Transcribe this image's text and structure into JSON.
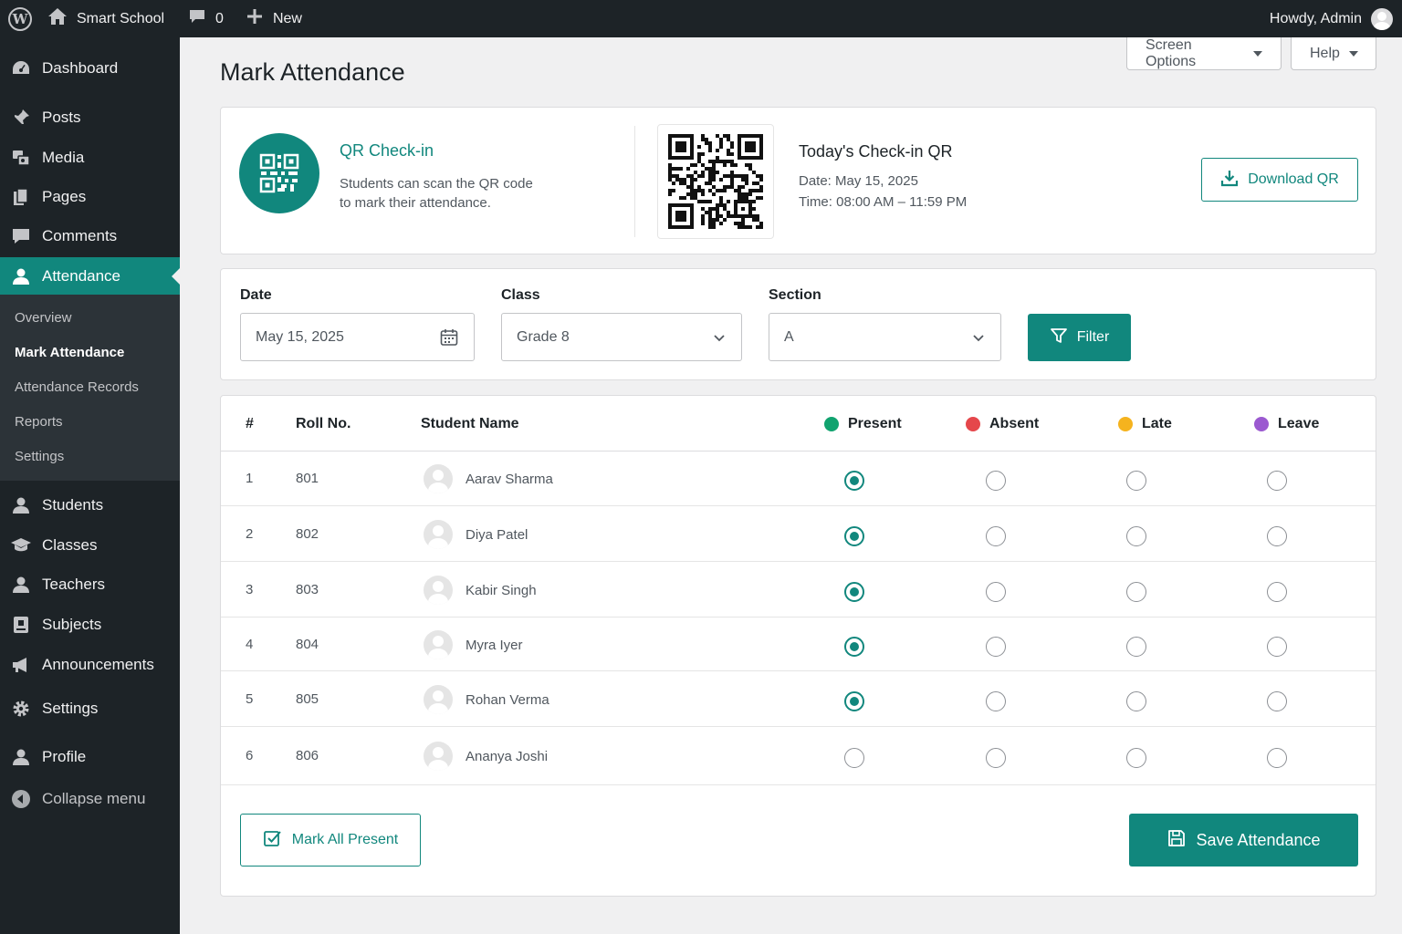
{
  "adminbar": {
    "site_name": "Smart School",
    "comments_count": "0",
    "new_label": "New",
    "howdy": "Howdy, Admin"
  },
  "sidebar": {
    "items": [
      {
        "label": "Dashboard",
        "icon": "dashboard-icon"
      },
      {
        "label": "Posts",
        "icon": "pin-icon"
      },
      {
        "label": "Media",
        "icon": "media-icon"
      },
      {
        "label": "Pages",
        "icon": "pages-icon"
      },
      {
        "label": "Comments",
        "icon": "comment-icon"
      },
      {
        "label": "Attendance",
        "icon": "user-icon"
      },
      {
        "label": "Students",
        "icon": "user-icon"
      },
      {
        "label": "Classes",
        "icon": "graduation-cap-icon"
      },
      {
        "label": "Teachers",
        "icon": "user-icon"
      },
      {
        "label": "Subjects",
        "icon": "book-icon"
      },
      {
        "label": "Announcements",
        "icon": "megaphone-icon"
      },
      {
        "label": "Settings",
        "icon": "gear-icon"
      },
      {
        "label": "Profile",
        "icon": "user-icon"
      }
    ],
    "submenu": [
      "Overview",
      "Mark Attendance",
      "Attendance Records",
      "Reports",
      "Settings"
    ],
    "collapse_label": "Collapse menu"
  },
  "header": {
    "title": "Mark Attendance",
    "screen_options": "Screen Options",
    "help": "Help"
  },
  "qr": {
    "title": "QR Check-in",
    "desc_line1": "Students can scan the QR code",
    "desc_line2": "to mark their attendance.",
    "heading": "Today's Check-in QR",
    "date": "Date: May 15, 2025",
    "time": "Time: 08:00 AM – 11:59 PM",
    "download_label": "Download QR"
  },
  "filters": {
    "date_label": "Date",
    "date_value": "May 15, 2025",
    "class_label": "Class",
    "class_value": "Grade 8",
    "section_label": "Section",
    "section_value": "A",
    "filter_label": "Filter"
  },
  "table": {
    "headers": {
      "num": "#",
      "roll": "Roll No.",
      "name": "Student Name",
      "present": "Present",
      "absent": "Absent",
      "late": "Late",
      "leave": "Leave"
    },
    "status_colors": {
      "present": "#11a36f",
      "absent": "#e5474b",
      "late": "#f5b31e",
      "leave": "#9b59d0"
    },
    "rows": [
      {
        "num": "1",
        "roll": "801",
        "name": "Aarav Sharma",
        "status": "present"
      },
      {
        "num": "2",
        "roll": "802",
        "name": "Diya Patel",
        "status": "present"
      },
      {
        "num": "3",
        "roll": "803",
        "name": "Kabir Singh",
        "status": "present"
      },
      {
        "num": "4",
        "roll": "804",
        "name": "Myra Iyer",
        "status": "present"
      },
      {
        "num": "5",
        "roll": "805",
        "name": "Rohan Verma",
        "status": "present"
      },
      {
        "num": "6",
        "roll": "806",
        "name": "Ananya Joshi",
        "status": ""
      }
    ],
    "mark_all_label": "Mark All Present",
    "save_label": "Save Attendance"
  },
  "accent": "#11877d"
}
